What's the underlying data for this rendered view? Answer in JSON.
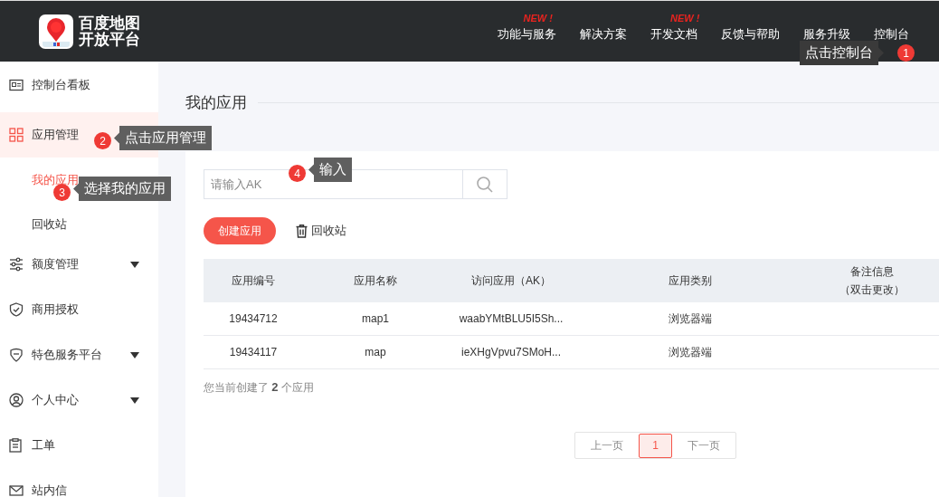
{
  "header": {
    "logo_lines": [
      "百度地图",
      "开放平台"
    ],
    "nav": [
      {
        "label": "功能与服务",
        "badge": "NEW !"
      },
      {
        "label": "解决方案"
      },
      {
        "label": "开发文档",
        "badge": "NEW !"
      },
      {
        "label": "反馈与帮助"
      },
      {
        "label": "服务升级"
      },
      {
        "label": "控制台"
      }
    ]
  },
  "sidebar": {
    "items": [
      {
        "label": "控制台看板",
        "kind": "card",
        "selected": false,
        "expandable": false
      },
      {
        "label": "应用管理",
        "kind": "grid",
        "selected": true,
        "expandable": true,
        "children": [
          {
            "label": "我的应用",
            "selected": true
          },
          {
            "label": "回收站",
            "selected": false
          }
        ]
      },
      {
        "label": "额度管理",
        "kind": "sliders",
        "selected": false,
        "expandable": true
      },
      {
        "label": "商用授权",
        "kind": "shield",
        "selected": false,
        "expandable": false
      },
      {
        "label": "特色服务平台",
        "kind": "tag",
        "selected": false,
        "expandable": true
      },
      {
        "label": "个人中心",
        "kind": "person",
        "selected": false,
        "expandable": true
      },
      {
        "label": "工单",
        "kind": "clipboard",
        "selected": false,
        "expandable": false
      },
      {
        "label": "站内信",
        "kind": "mail",
        "selected": false,
        "expandable": false
      }
    ]
  },
  "page_title": "我的应用",
  "search": {
    "placeholder": "请输入AK"
  },
  "create_button": "创建应用",
  "recycle_link": "回收站",
  "table": {
    "columns": [
      {
        "label": "应用编号"
      },
      {
        "label": "应用名称"
      },
      {
        "label": "访问应用（AK）"
      },
      {
        "label": "应用类别"
      },
      {
        "label": "备注信息",
        "note": "（双击更改）"
      }
    ],
    "rows": [
      [
        "19434712",
        "map1",
        "waabYMtBLU5I5Sh...",
        "浏览器端",
        ""
      ],
      [
        "19434117",
        "map",
        "ieXHgVpvu7SMoH...",
        "浏览器端",
        ""
      ]
    ]
  },
  "summary": "您当前创建了 **2** 个应用",
  "pagination": {
    "prev": "上一页",
    "pages": [
      {
        "label": "1",
        "selected": true
      }
    ],
    "next": "下一页"
  },
  "annotations": [
    {
      "number": "1",
      "text": "点击控制台"
    },
    {
      "number": "2",
      "text": "点击应用管理"
    },
    {
      "number": "3",
      "text": "选择我的应用"
    },
    {
      "number": "4",
      "text": "输入"
    }
  ]
}
